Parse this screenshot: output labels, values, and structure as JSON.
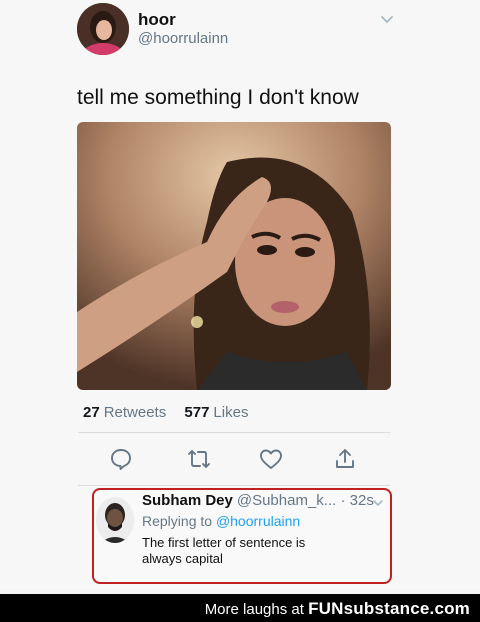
{
  "tweet": {
    "display_name": "hoor",
    "handle": "@hoorrulainn",
    "text": "tell me something I don't know",
    "retweets_count": "27",
    "retweets_label": "Retweets",
    "likes_count": "577",
    "likes_label": "Likes"
  },
  "reply": {
    "display_name": "Subham Dey",
    "handle_time": "@Subham_k... · 32s",
    "replying_prefix": "Replying to",
    "replying_handle": "@hoorrulainn",
    "text": "The first letter of sentence is always capital",
    "highlight_color": "#c0211f"
  },
  "footer": {
    "prefix": "More laughs at",
    "brand": "FUNsubstance.com"
  },
  "icons": [
    "caret-down-icon",
    "reply-icon",
    "retweet-icon",
    "like-icon",
    "share-icon"
  ],
  "colors": {
    "link": "#1da1f2",
    "muted": "#657786"
  }
}
